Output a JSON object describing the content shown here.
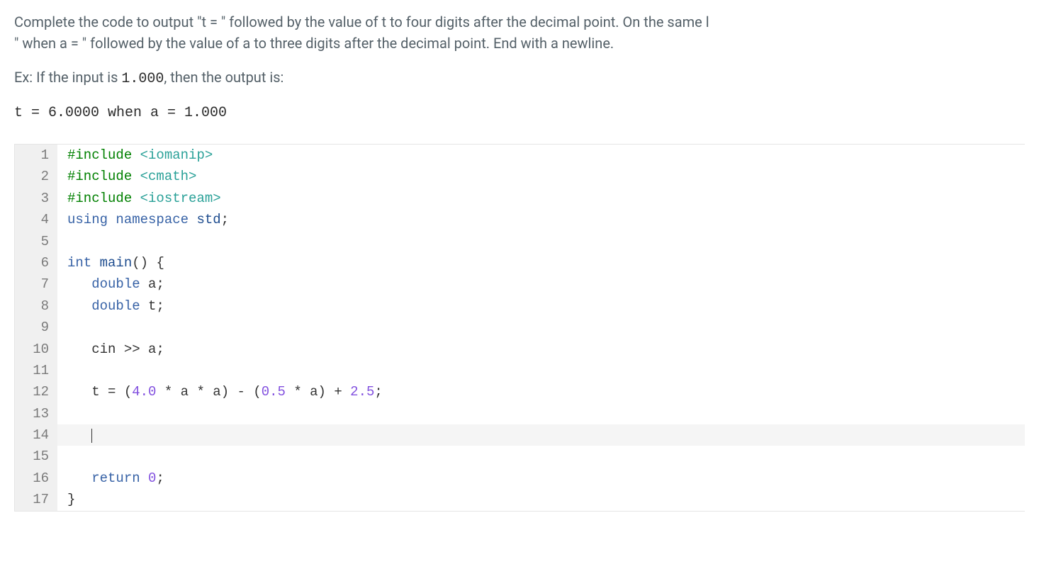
{
  "instruction": {
    "line1": "Complete the code to output \"t = \" followed by the value of t to four digits after the decimal point. On the same l",
    "line2": "\" when a = \" followed by the value of a to three digits after the decimal point. End with a newline."
  },
  "example": {
    "prefix": "Ex: If the input is ",
    "input": "1.000",
    "suffix": ", then the output is:"
  },
  "output_line": "t = 6.0000 when a = 1.000",
  "code": {
    "lines": [
      {
        "n": 1,
        "tokens": [
          {
            "t": "#include",
            "c": "kw-green"
          },
          {
            "t": " ",
            "c": "plain"
          },
          {
            "t": "<iomanip>",
            "c": "kw-teal"
          }
        ]
      },
      {
        "n": 2,
        "tokens": [
          {
            "t": "#include",
            "c": "kw-green"
          },
          {
            "t": " ",
            "c": "plain"
          },
          {
            "t": "<cmath>",
            "c": "kw-teal"
          }
        ]
      },
      {
        "n": 3,
        "tokens": [
          {
            "t": "#include",
            "c": "kw-green"
          },
          {
            "t": " ",
            "c": "plain"
          },
          {
            "t": "<iostream>",
            "c": "kw-teal"
          }
        ]
      },
      {
        "n": 4,
        "tokens": [
          {
            "t": "using",
            "c": "kw-blue"
          },
          {
            "t": " ",
            "c": "plain"
          },
          {
            "t": "namespace",
            "c": "kw-blue"
          },
          {
            "t": " ",
            "c": "plain"
          },
          {
            "t": "std",
            "c": "kw-dblue"
          },
          {
            "t": ";",
            "c": "plain"
          }
        ]
      },
      {
        "n": 5,
        "tokens": []
      },
      {
        "n": 6,
        "tokens": [
          {
            "t": "int",
            "c": "kw-blue"
          },
          {
            "t": " ",
            "c": "plain"
          },
          {
            "t": "main",
            "c": "kw-dblue"
          },
          {
            "t": "() {",
            "c": "plain"
          }
        ]
      },
      {
        "n": 7,
        "tokens": [
          {
            "t": "   ",
            "c": "plain"
          },
          {
            "t": "double",
            "c": "kw-blue"
          },
          {
            "t": " a;",
            "c": "plain"
          }
        ]
      },
      {
        "n": 8,
        "tokens": [
          {
            "t": "   ",
            "c": "plain"
          },
          {
            "t": "double",
            "c": "kw-blue"
          },
          {
            "t": " t;",
            "c": "plain"
          }
        ]
      },
      {
        "n": 9,
        "tokens": []
      },
      {
        "n": 10,
        "tokens": [
          {
            "t": "   cin ",
            "c": "plain"
          },
          {
            "t": ">>",
            "c": "plain"
          },
          {
            "t": " a;",
            "c": "plain"
          }
        ]
      },
      {
        "n": 11,
        "tokens": []
      },
      {
        "n": 12,
        "tokens": [
          {
            "t": "   t ",
            "c": "plain"
          },
          {
            "t": "=",
            "c": "plain"
          },
          {
            "t": " (",
            "c": "plain"
          },
          {
            "t": "4.0",
            "c": "kw-purple"
          },
          {
            "t": " ",
            "c": "plain"
          },
          {
            "t": "*",
            "c": "plain"
          },
          {
            "t": " a ",
            "c": "plain"
          },
          {
            "t": "*",
            "c": "plain"
          },
          {
            "t": " a) ",
            "c": "plain"
          },
          {
            "t": "-",
            "c": "plain"
          },
          {
            "t": " (",
            "c": "plain"
          },
          {
            "t": "0.5",
            "c": "kw-purple"
          },
          {
            "t": " ",
            "c": "plain"
          },
          {
            "t": "*",
            "c": "plain"
          },
          {
            "t": " a) ",
            "c": "plain"
          },
          {
            "t": "+",
            "c": "plain"
          },
          {
            "t": " ",
            "c": "plain"
          },
          {
            "t": "2.5",
            "c": "kw-purple"
          },
          {
            "t": ";",
            "c": "plain"
          }
        ]
      },
      {
        "n": 13,
        "tokens": []
      },
      {
        "n": 14,
        "tokens": [
          {
            "t": "   ",
            "c": "plain"
          }
        ],
        "highlight": true,
        "cursor": true
      },
      {
        "n": 15,
        "tokens": []
      },
      {
        "n": 16,
        "tokens": [
          {
            "t": "   ",
            "c": "plain"
          },
          {
            "t": "return",
            "c": "kw-blue"
          },
          {
            "t": " ",
            "c": "plain"
          },
          {
            "t": "0",
            "c": "kw-purple"
          },
          {
            "t": ";",
            "c": "plain"
          }
        ]
      },
      {
        "n": 17,
        "tokens": [
          {
            "t": "}",
            "c": "plain"
          }
        ]
      }
    ]
  }
}
